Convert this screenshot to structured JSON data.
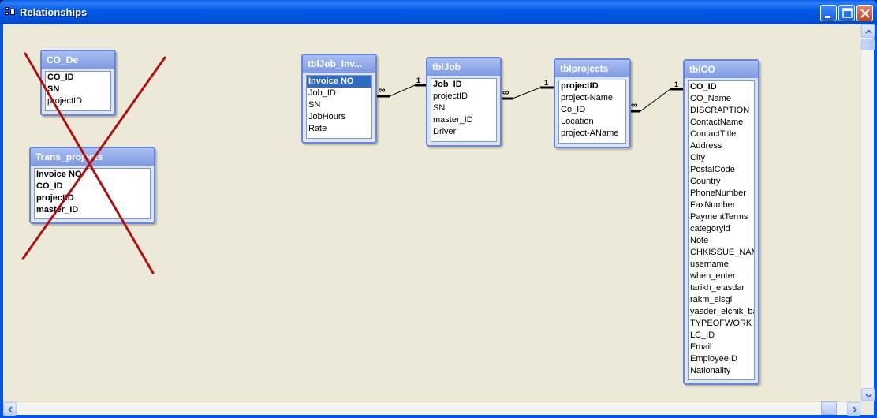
{
  "window": {
    "title": "Relationships",
    "buttons": [
      "minimize",
      "maximize",
      "close"
    ]
  },
  "tables": {
    "co_de": {
      "name": "CO_De",
      "fields": [
        {
          "name": "CO_ID",
          "primary": true
        },
        {
          "name": "SN",
          "primary": true
        },
        {
          "name": "projectID",
          "primary": false
        }
      ]
    },
    "trans_projects": {
      "name": "Trans_projects",
      "fields": [
        {
          "name": "Invoice NO",
          "primary": true
        },
        {
          "name": "CO_ID",
          "primary": true
        },
        {
          "name": "projectID",
          "primary": true
        },
        {
          "name": "master_ID",
          "primary": true
        }
      ]
    },
    "tbljob_inv": {
      "name": "tblJob_Inv...",
      "fields": [
        {
          "name": "Invoice NO",
          "primary": true,
          "selected": true
        },
        {
          "name": "Job_ID",
          "primary": false
        },
        {
          "name": "SN",
          "primary": false
        },
        {
          "name": "JobHours",
          "primary": false
        },
        {
          "name": "Rate",
          "primary": false
        }
      ]
    },
    "tbljob": {
      "name": "tblJob",
      "fields": [
        {
          "name": "Job_ID",
          "primary": true
        },
        {
          "name": "projectID",
          "primary": false
        },
        {
          "name": "SN",
          "primary": false
        },
        {
          "name": "master_ID",
          "primary": false
        },
        {
          "name": "Driver",
          "primary": false
        }
      ]
    },
    "tblprojects": {
      "name": "tblprojects",
      "fields": [
        {
          "name": "projectID",
          "primary": true
        },
        {
          "name": "project-Name",
          "primary": false
        },
        {
          "name": "Co_ID",
          "primary": false
        },
        {
          "name": "Location",
          "primary": false
        },
        {
          "name": "project-AName",
          "primary": false
        }
      ]
    },
    "tblco": {
      "name": "tblCO",
      "fields": [
        {
          "name": "CO_ID",
          "primary": true
        },
        {
          "name": "CO_Name",
          "primary": false
        },
        {
          "name": "DISCRAPTION",
          "primary": false
        },
        {
          "name": "ContactName",
          "primary": false
        },
        {
          "name": "ContactTitle",
          "primary": false
        },
        {
          "name": "Address",
          "primary": false
        },
        {
          "name": "City",
          "primary": false
        },
        {
          "name": "PostalCode",
          "primary": false
        },
        {
          "name": "Country",
          "primary": false
        },
        {
          "name": "PhoneNumber",
          "primary": false
        },
        {
          "name": "FaxNumber",
          "primary": false
        },
        {
          "name": "PaymentTerms",
          "primary": false
        },
        {
          "name": "categoryid",
          "primary": false
        },
        {
          "name": "Note",
          "primary": false
        },
        {
          "name": "CHKISSUE_NAME",
          "primary": false
        },
        {
          "name": "username",
          "primary": false
        },
        {
          "name": "when_enter",
          "primary": false
        },
        {
          "name": "tarikh_elasdar",
          "primary": false
        },
        {
          "name": "rakm_elsgl",
          "primary": false
        },
        {
          "name": "yasder_elchik_ba",
          "primary": false
        },
        {
          "name": "TYPEOFWORK",
          "primary": false
        },
        {
          "name": "LC_ID",
          "primary": false
        },
        {
          "name": "Email",
          "primary": false
        },
        {
          "name": "EmployeeID",
          "primary": false
        },
        {
          "name": "Nationality",
          "primary": false
        }
      ]
    }
  },
  "relationships": [
    {
      "from": "tbljob_inv",
      "many_label": "∞",
      "to": "tbljob",
      "one_label": "1"
    },
    {
      "from": "tbljob",
      "many_label": "∞",
      "to": "tblprojects",
      "one_label": "1"
    },
    {
      "from": "tblprojects",
      "many_label": "∞",
      "to": "tblco",
      "one_label": "1"
    }
  ],
  "annotation": {
    "type": "red-x",
    "color": "#b01010"
  }
}
